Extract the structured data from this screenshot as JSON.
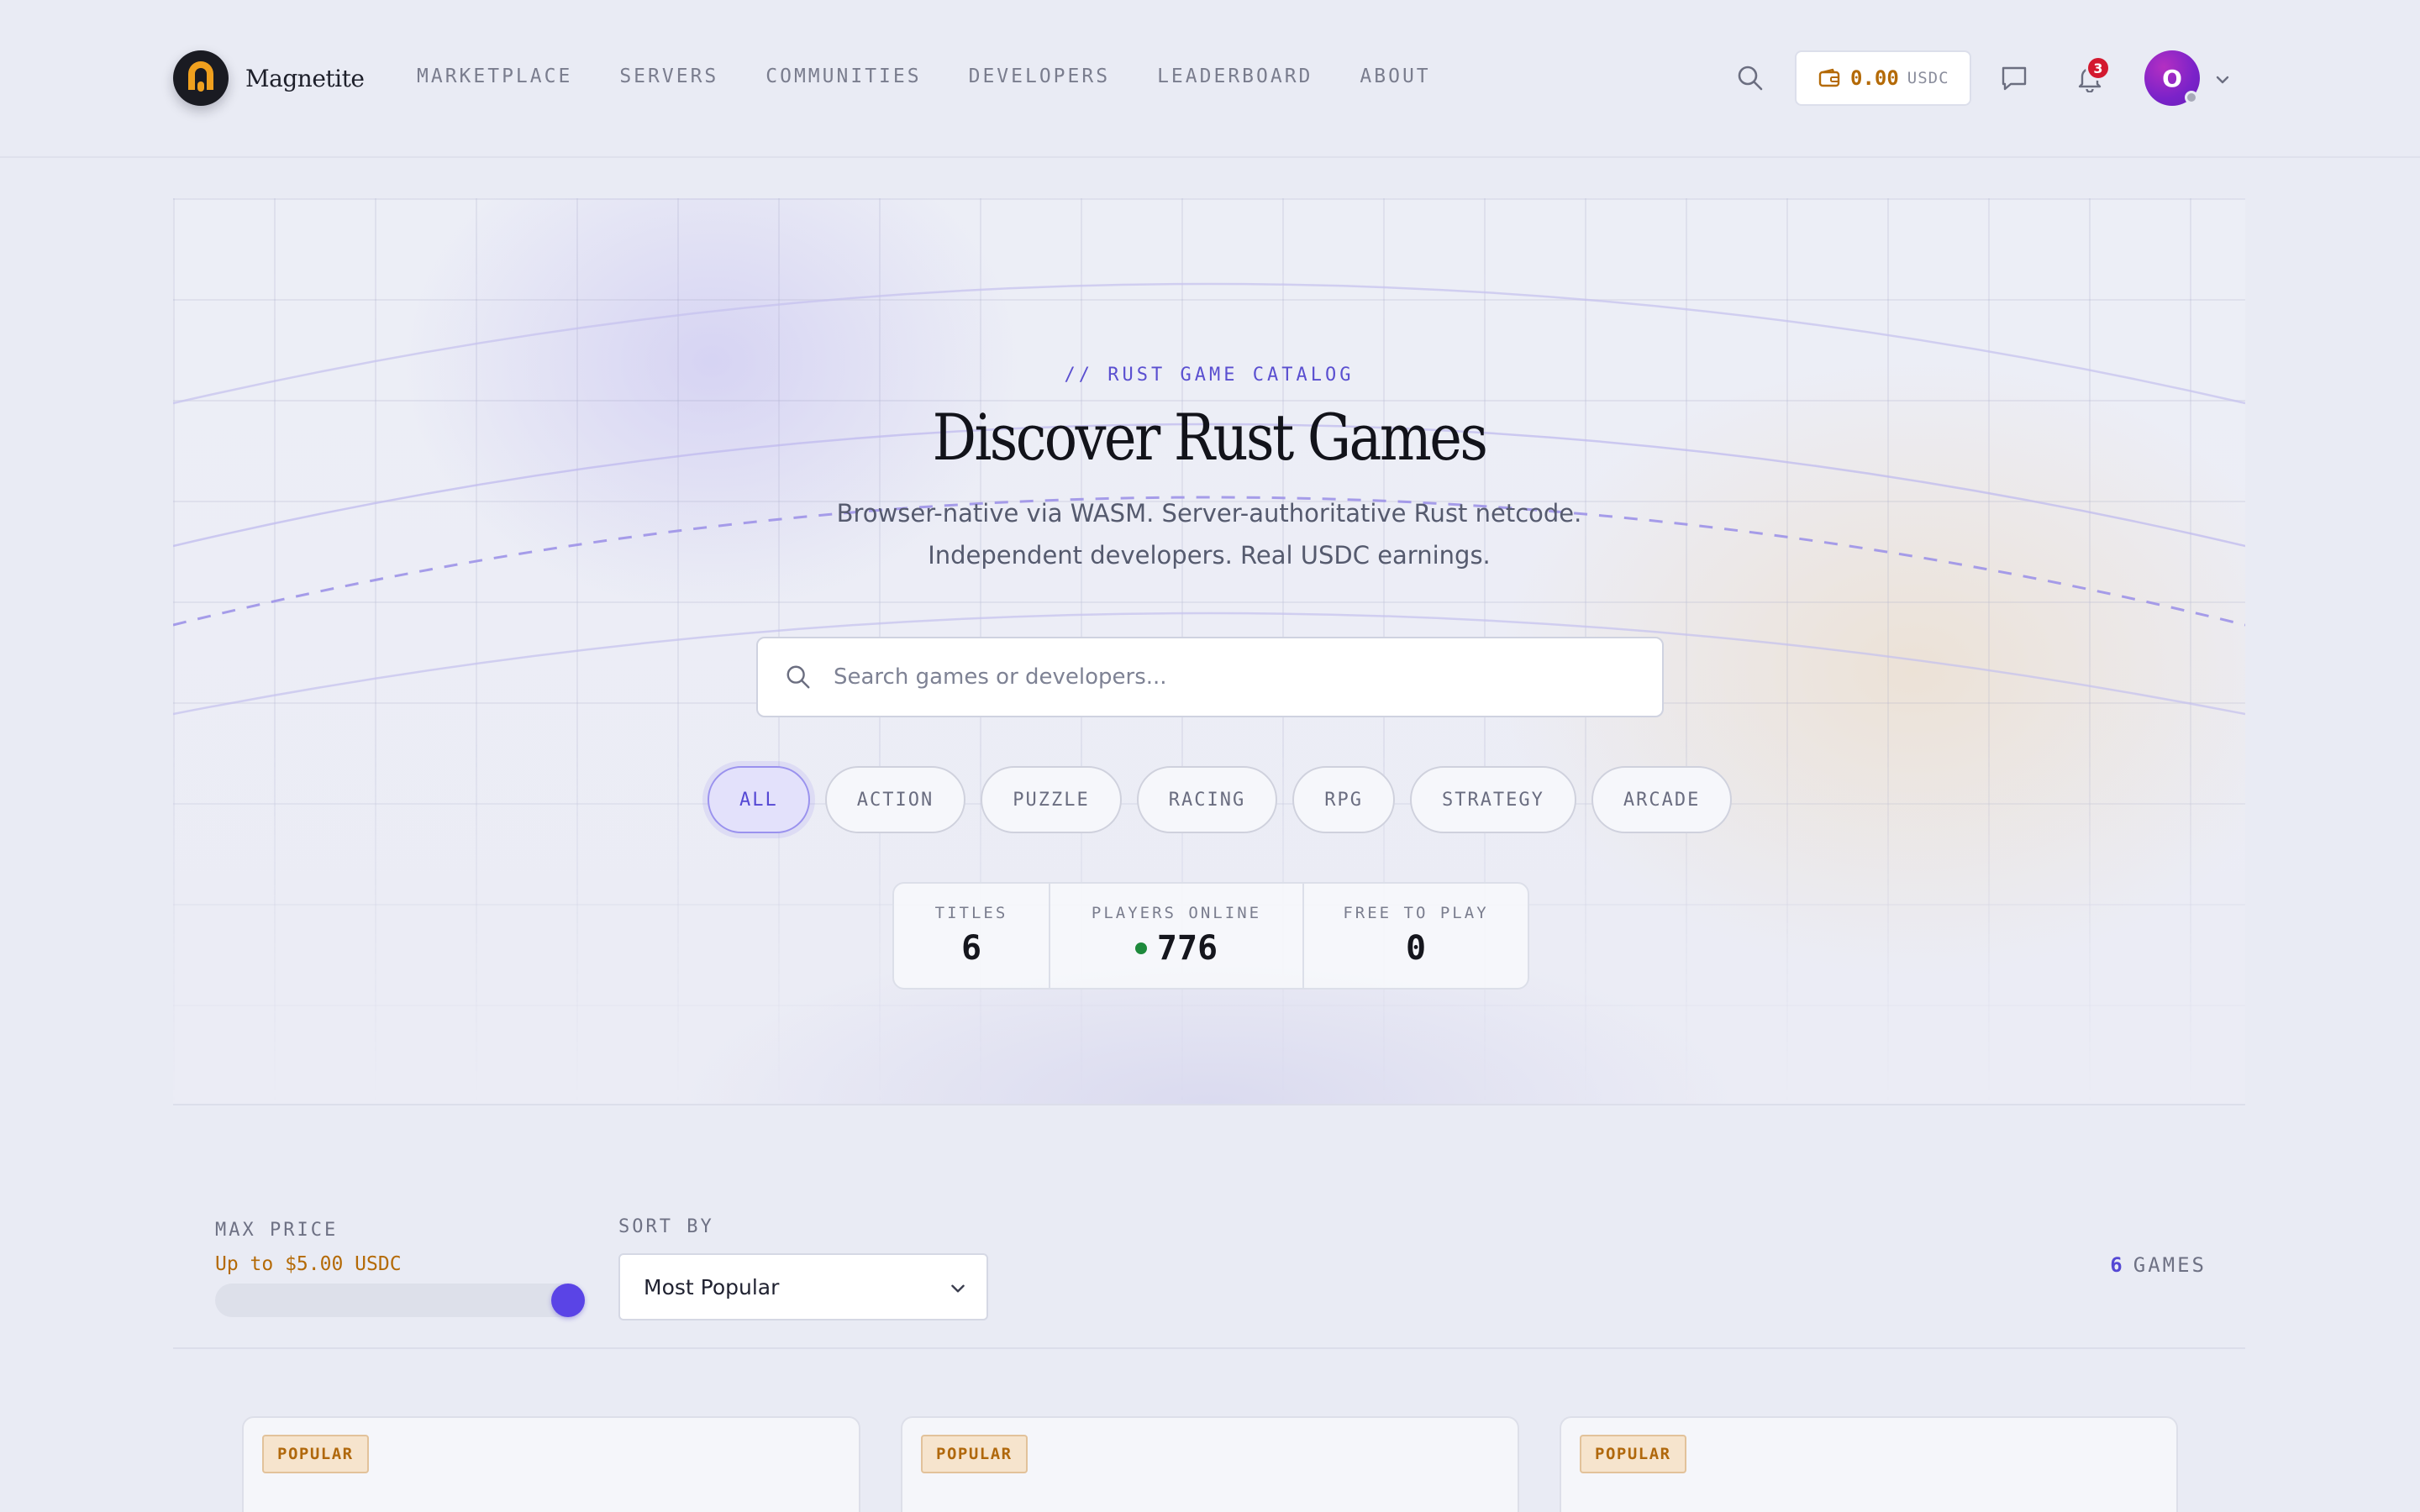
{
  "header": {
    "brand_name": "Magnetite",
    "nav": [
      "MARKETPLACE",
      "SERVERS",
      "COMMUNITIES",
      "DEVELOPERS",
      "LEADERBOARD",
      "ABOUT"
    ],
    "wallet": {
      "amount": "0.00",
      "unit": "USDC"
    },
    "notifications_count": "3",
    "avatar_initial": "O"
  },
  "hero": {
    "eyebrow": "// RUST GAME CATALOG",
    "title": "Discover Rust Games",
    "subtitle_line1": "Browser-native via WASM. Server-authoritative Rust netcode.",
    "subtitle_line2": "Independent developers. Real USDC earnings.",
    "search_placeholder": "Search games or developers...",
    "categories": [
      "ALL",
      "ACTION",
      "PUZZLE",
      "RACING",
      "RPG",
      "STRATEGY",
      "ARCADE"
    ],
    "active_category": "ALL",
    "stats": [
      {
        "label": "TITLES",
        "value": "6"
      },
      {
        "label": "PLAYERS ONLINE",
        "value": "776"
      },
      {
        "label": "FREE TO PLAY",
        "value": "0"
      }
    ]
  },
  "filters": {
    "max_price_label": "MAX PRICE",
    "max_price_value": "Up to $5.00 USDC",
    "max_price_fraction": 1.0,
    "sort_label": "SORT BY",
    "sort_value": "Most Popular",
    "games_count": "6",
    "games_label": "GAMES"
  },
  "cards": [
    {
      "badge": "POPULAR"
    },
    {
      "badge": "POPULAR"
    },
    {
      "badge": "POPULAR"
    }
  ],
  "colors": {
    "accent": "#5548d4",
    "gold": "#b46a06",
    "online": "#1e8a3c",
    "badge_red": "#d3192f"
  },
  "icons": [
    "search-icon",
    "wallet-icon",
    "chat-icon",
    "bell-icon",
    "chevron-down-icon"
  ]
}
